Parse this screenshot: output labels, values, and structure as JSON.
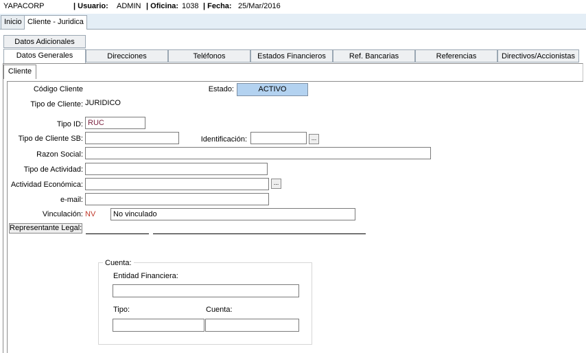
{
  "header": {
    "company": "YAPACORP",
    "user_label": "| Usuario:",
    "user_value": "ADMIN",
    "office_label": "| Oficina:",
    "office_value": "1038",
    "date_label": "| Fecha:",
    "date_value": "25/Mar/2016"
  },
  "top_tabs": [
    {
      "label": "Inicio"
    },
    {
      "label": "Cliente - Juridica"
    }
  ],
  "tabs_row1": [
    {
      "label": "Datos Adicionales"
    }
  ],
  "tabs_row2": [
    {
      "label": "Datos Generales"
    },
    {
      "label": "Direcciones"
    },
    {
      "label": "Teléfonos"
    },
    {
      "label": "Estados Financieros"
    },
    {
      "label": "Ref. Bancarias"
    },
    {
      "label": "Referencias"
    },
    {
      "label": "Directivos/Accionistas"
    }
  ],
  "sub_tab": "Cliente",
  "form": {
    "codigo_label": "Código Cliente",
    "estado_label": "Estado:",
    "estado_value": "ACTIVO",
    "tipo_cliente_label": "Tipo de Cliente:",
    "tipo_cliente_value": "JURIDICO",
    "tipo_id_label": "Tipo ID:",
    "tipo_id_value": "RUC",
    "tipo_cliente_sb_label": "Tipo de Cliente SB:",
    "identificacion_label": "Identificación:",
    "razon_social_label": "Razon Social:",
    "tipo_actividad_label": "Tipo de Actividad:",
    "actividad_economica_label": "Actividad Económica:",
    "email_label": "e-mail:",
    "vinculacion_label": "Vinculación:",
    "vinculacion_code": "NV",
    "vinculacion_value": "No vinculado",
    "representante_label": "Representante Legal:",
    "lookup_label": "..."
  },
  "cuenta": {
    "legend": "Cuenta:",
    "entidad_label": "Entidad Financiera:",
    "tipo_label": "Tipo:",
    "cuenta_label": "Cuenta:"
  },
  "colors": {
    "estado_bg": "#b3d2f0",
    "tab_strip": "#e4eef6",
    "code_red": "#c0392b",
    "id_maroon": "#7a1f3d"
  }
}
